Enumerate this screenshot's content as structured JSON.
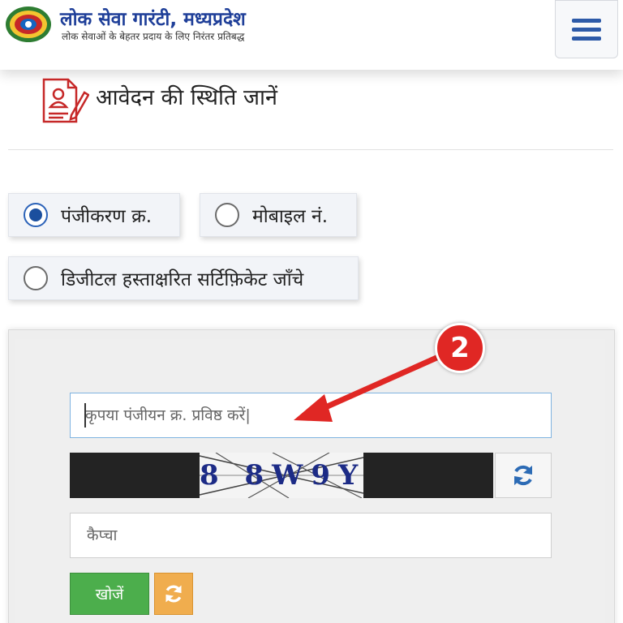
{
  "header": {
    "title": "लोक सेवा गारंटी, मध्यप्रदेश",
    "subtitle": "लोक सेवाओं के बेहतर प्रदाय के लिए निरंतर प्रतिबद्ध",
    "logo_icon": "mp-emblem-icon",
    "menu_icon": "hamburger-menu-icon"
  },
  "status": {
    "icon": "application-form-icon",
    "title": "आवेदन की स्थिति जानें"
  },
  "search_options": {
    "selected": "पंजीकरण क्र.",
    "options": [
      {
        "label": "पंजीकरण क्र.",
        "checked": true
      },
      {
        "label": "मोबाइल नं.",
        "checked": false
      },
      {
        "label": "डिजीटल हस्ताक्षरित सर्टिफ़िकेट जाँचे",
        "checked": false
      }
    ]
  },
  "form": {
    "registration_placeholder": "कृपया पंजीयन क्र. प्रविष्ठ करें|",
    "registration_value": "",
    "captcha_code": "8 8W9Y",
    "captcha_refresh_icon": "refresh-icon",
    "captcha_placeholder": "कैप्चा",
    "captcha_value": "",
    "search_label": "खोजें",
    "reset_icon": "refresh-icon"
  },
  "annotation": {
    "badge_number": "2",
    "arrow_icon": "red-arrow-icon"
  },
  "colors": {
    "title_blue": "#1f3f99",
    "radio_blue": "#1b4f9e",
    "search_green": "#4cae4c",
    "reset_orange": "#f0ad4e",
    "badge_red": "#e02724"
  }
}
